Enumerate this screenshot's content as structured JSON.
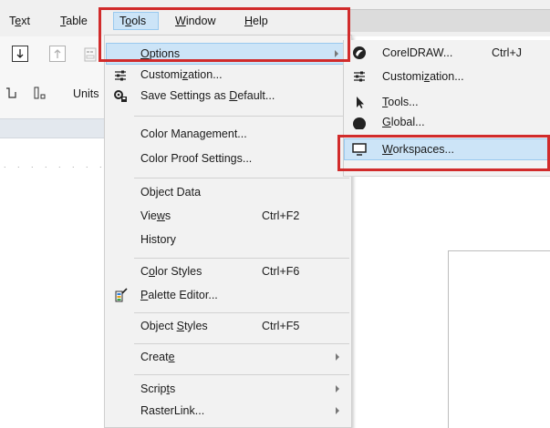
{
  "menubar": {
    "items": [
      {
        "label": "Text",
        "mnemonic_index": 1
      },
      {
        "label": "Table",
        "mnemonic_index": 0
      },
      {
        "label": "Tools",
        "mnemonic_index": 1
      },
      {
        "label": "Window",
        "mnemonic_index": 0
      },
      {
        "label": "Help",
        "mnemonic_index": 0
      }
    ]
  },
  "toolbar": {
    "units_label": "Units"
  },
  "tools_menu": {
    "items": [
      {
        "label": "Options",
        "has_submenu": true,
        "highlighted": true
      },
      {
        "label": "Customization..."
      },
      {
        "label": "Save Settings as Default..."
      },
      {
        "label": "Color Management..."
      },
      {
        "label": "Color Proof Settings..."
      },
      {
        "label": "Object Data"
      },
      {
        "label": "Views",
        "shortcut": "Ctrl+F2"
      },
      {
        "label": "History"
      },
      {
        "label": "Color Styles",
        "shortcut": "Ctrl+F6"
      },
      {
        "label": "Palette Editor..."
      },
      {
        "label": "Object Styles",
        "shortcut": "Ctrl+F5"
      },
      {
        "label": "Create",
        "has_submenu": true
      },
      {
        "label": "Scripts",
        "has_submenu": true
      },
      {
        "label": "RasterLink...",
        "has_submenu": true
      }
    ]
  },
  "options_submenu": {
    "items": [
      {
        "label": "CorelDRAW...",
        "shortcut": "Ctrl+J",
        "icon": "coreldraw-icon"
      },
      {
        "label": "Customization...",
        "icon": "sliders-icon"
      },
      {
        "label": "Tools...",
        "icon": "pointer-icon"
      },
      {
        "label": "Global...",
        "icon": "globe-icon"
      },
      {
        "label": "Workspaces...",
        "icon": "monitor-icon",
        "highlighted": true
      }
    ]
  },
  "colors": {
    "highlight_bg": "#cce4f7",
    "highlight_border": "#99c9ef",
    "annotation_red": "#d12b2b",
    "menu_bg": "#f2f2f2"
  }
}
